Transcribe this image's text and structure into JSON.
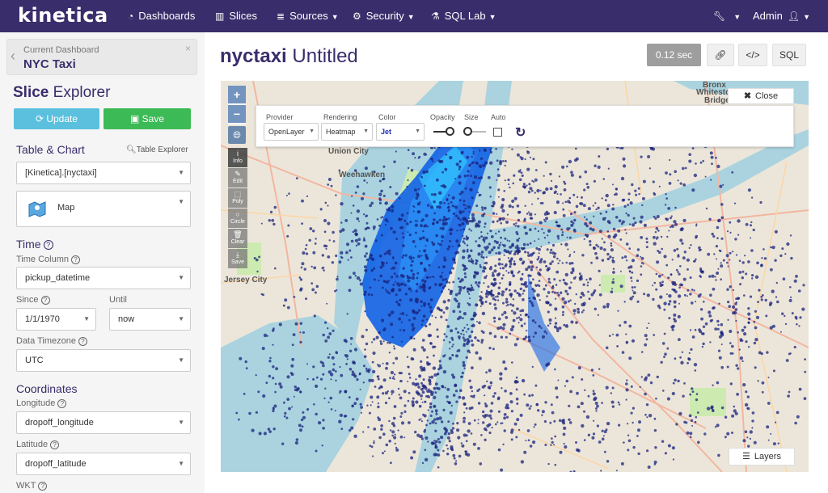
{
  "navbar": {
    "brand": "kinetica",
    "items": [
      {
        "label": "Dashboards",
        "icon": "dashboard-icon"
      },
      {
        "label": "Slices",
        "icon": "bar-chart-icon"
      },
      {
        "label": "Sources",
        "icon": "database-icon"
      },
      {
        "label": "Security",
        "icon": "gears-icon"
      },
      {
        "label": "SQL Lab",
        "icon": "flask-icon"
      }
    ],
    "admin_label": "Admin"
  },
  "sidebar": {
    "current_dashboard_label": "Current Dashboard",
    "current_dashboard_value": "NYC Taxi",
    "slice_title_bold": "Slice",
    "slice_title_rest": " Explorer",
    "update_label": "Update",
    "save_label": "Save",
    "table_chart_heading": "Table & Chart",
    "table_explorer_label": "Table Explorer",
    "table_value": "[Kinetica].[nyctaxi]",
    "chart_type": "Map",
    "time_heading": "Time",
    "time_column_label": "Time Column",
    "time_column_value": "pickup_datetime",
    "since_label": "Since",
    "since_value": "1/1/1970",
    "until_label": "Until",
    "until_value": "now",
    "timezone_label": "Data Timezone",
    "timezone_value": "UTC",
    "coordinates_heading": "Coordinates",
    "longitude_label": "Longitude",
    "longitude_value": "dropoff_longitude",
    "latitude_label": "Latitude",
    "latitude_value": "dropoff_latitude",
    "wkt_label": "WKT"
  },
  "main": {
    "title_bold": "nyctaxi",
    "title_rest": " Untitled",
    "timer": "0.12 sec",
    "sql_label": "SQL"
  },
  "map": {
    "zoom_in": "+",
    "zoom_out": "−",
    "tools": [
      "Info",
      "Edit",
      "Poly",
      "Circle",
      "Clear",
      "Save"
    ],
    "close_label": "Close",
    "layers_label": "Layers",
    "controls": {
      "provider_label": "Provider",
      "provider_value": "OpenLayer",
      "rendering_label": "Rendering",
      "rendering_value": "Heatmap",
      "color_label": "Color",
      "color_value": "Jet",
      "opacity_label": "Opacity",
      "size_label": "Size",
      "auto_label": "Auto"
    },
    "place_labels": {
      "union_city": "Union City",
      "weehawken": "Weehawken",
      "jersey_city": "Jersey City",
      "bronx": "Bronx",
      "whitestone": "Whitestone",
      "bridge": "Bridge"
    }
  },
  "colors": {
    "navbar": "#3a2d6b",
    "update": "#5bc0de",
    "save": "#3cba55",
    "heat_core": "#1565e6",
    "points": "#1a237e"
  }
}
